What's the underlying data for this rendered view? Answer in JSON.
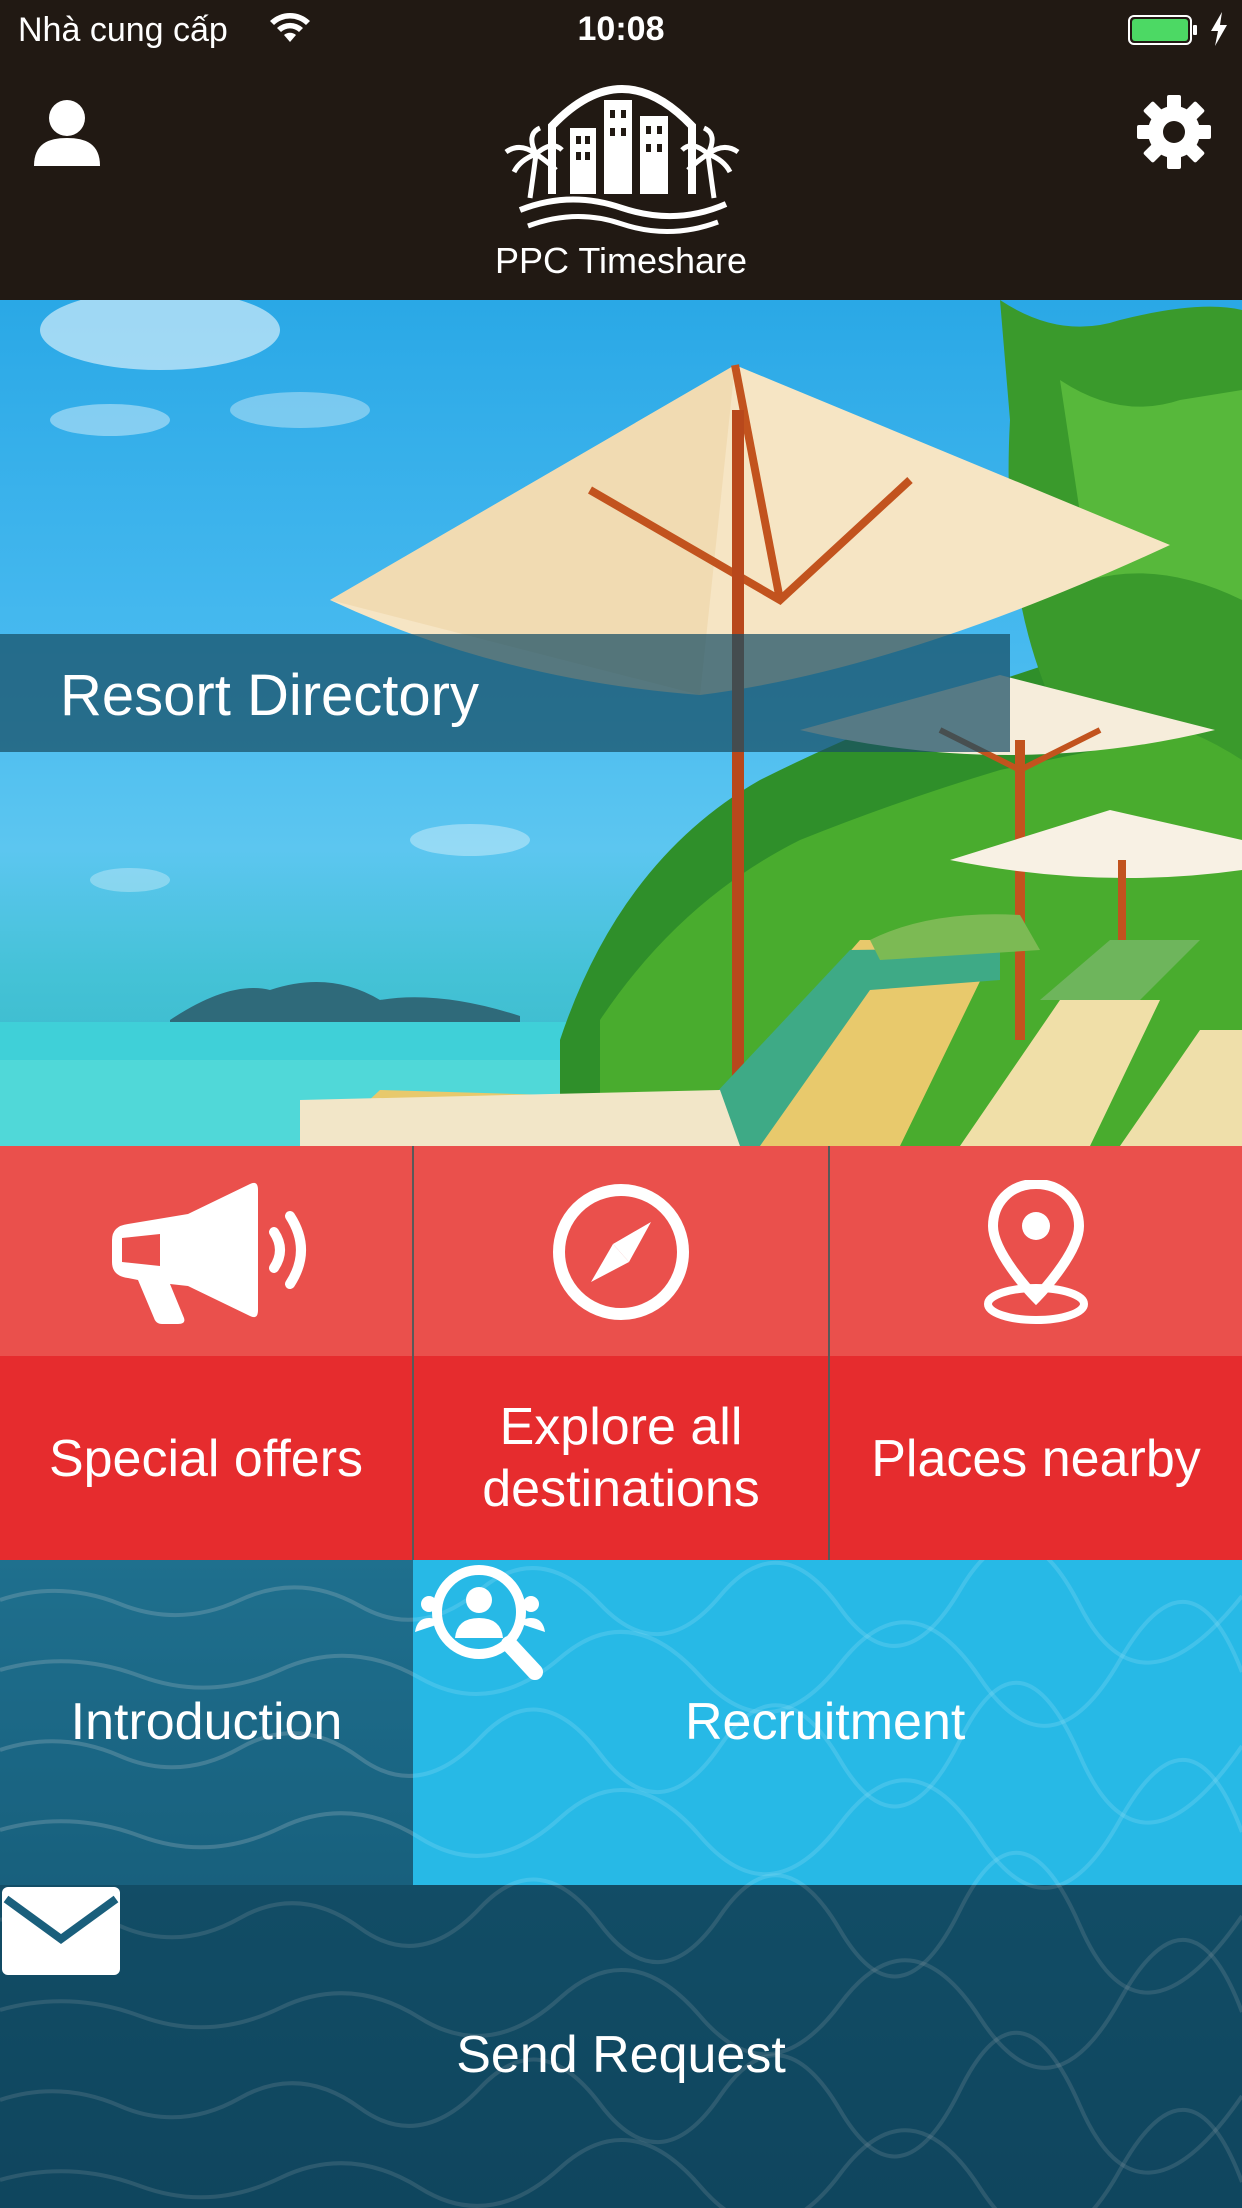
{
  "status_bar": {
    "carrier": "Nhà cung cấp",
    "time": "10:08",
    "battery_color": "#4cd964"
  },
  "header": {
    "brand_name": "PPC Timeshare",
    "left_icon": "user-icon",
    "right_icon": "gear-icon",
    "background": "#211913"
  },
  "hero": {
    "label": "Resort Directory"
  },
  "tiles": [
    {
      "label": "Special offers",
      "icon": "megaphone-icon"
    },
    {
      "label_line1": "Explore all",
      "label_line2": "destinations",
      "icon": "compass-icon"
    },
    {
      "label": "Places nearby",
      "icon": "location-pin-icon"
    }
  ],
  "tile_colors": {
    "top": "#ea504c",
    "bottom": "#e62c2e"
  },
  "bottom": {
    "introduction": "Introduction",
    "recruitment": "Recruitment",
    "send_request": "Send Request"
  }
}
